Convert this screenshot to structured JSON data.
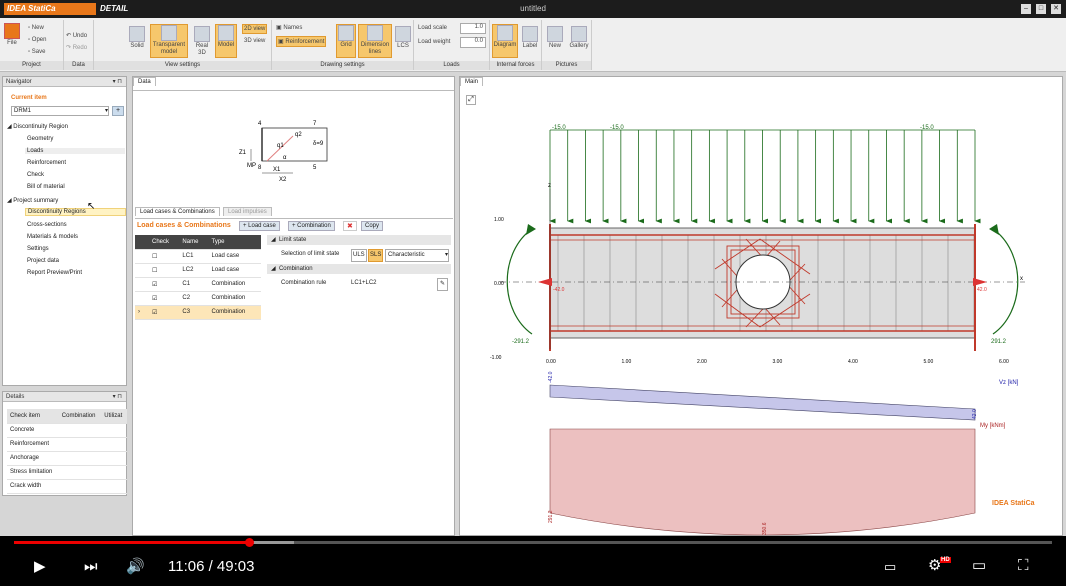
{
  "window": {
    "brand": "IDEA StatiCa",
    "app": "DETAIL",
    "title": "untitled"
  },
  "ribbon": {
    "file": "File",
    "project": {
      "new": "New",
      "open": "Open",
      "save": "Save",
      "label": "Project"
    },
    "data": {
      "undo": "Undo",
      "redo": "Redo",
      "label": "Data"
    },
    "view": {
      "solid": "Solid",
      "transparent": "Transparent model",
      "real3d": "Real 3D",
      "model": "Model",
      "v2d": "2D view",
      "v3d": "3D view",
      "label": "View settings"
    },
    "drawing": {
      "names": "Names",
      "reinforcement": "Reinforcement",
      "grid": "Grid",
      "dim": "Dimension lines",
      "lcs": "LCS",
      "label": "Drawing settings"
    },
    "loads": {
      "scale_label": "Load scale",
      "scale": "1.0",
      "weight_label": "Load weight",
      "weight": "0.0",
      "label": "Loads"
    },
    "forces": {
      "diagram": "Diagram",
      "label_btn": "Label",
      "label": "Internal forces"
    },
    "pictures": {
      "new": "New",
      "gallery": "Gallery",
      "label": "Pictures"
    }
  },
  "navigator": {
    "title": "Navigator",
    "current_item": "Current item",
    "current_value": "DRM1",
    "tree": [
      "Discontinuity Region",
      "Geometry",
      "Loads",
      "Reinforcement",
      "Check",
      "Bill of material",
      "Project summary",
      "Discontinuity Regions",
      "Cross-sections",
      "Materials & models",
      "Settings",
      "Project data",
      "Report Preview/Print"
    ]
  },
  "details": {
    "title": "Details",
    "headers": [
      "Check item",
      "Combination",
      "Utilizat"
    ],
    "rows": [
      "Concrete",
      "Reinforcement",
      "Anchorage",
      "Stress limitation",
      "Crack width"
    ]
  },
  "data_panel": {
    "tab": "Data",
    "tabs": [
      "Load cases & Combinations",
      "Load impulses"
    ],
    "heading": "Load cases & Combinations",
    "buttons": [
      "Load case",
      "Combination",
      "Copy"
    ],
    "headers": [
      "Check",
      "Name",
      "Type"
    ],
    "rows": [
      {
        "name": "LC1",
        "type": "Load case",
        "checked": false
      },
      {
        "name": "LC2",
        "type": "Load case",
        "checked": false
      },
      {
        "name": "C1",
        "type": "Combination",
        "checked": true
      },
      {
        "name": "C2",
        "type": "Combination",
        "checked": true
      },
      {
        "name": "C3",
        "type": "Combination",
        "checked": true
      }
    ],
    "props": {
      "limit_state": "Limit state",
      "sel_label": "Selection of limit state",
      "uls": "ULS",
      "sls": "SLS",
      "chars": "Characteristic",
      "combination": "Combination",
      "rule_label": "Combination rule",
      "rule": "LC1+LC2"
    },
    "sketch": {
      "n4": "4",
      "n7": "7",
      "n8": "8",
      "n5": "5",
      "q1": "q1",
      "q2": "q2",
      "alpha": "α",
      "delta": "δ=9",
      "z1": "Z1",
      "x1": "X1",
      "x2": "X2",
      "mp": "MP"
    }
  },
  "main_panel": {
    "tab": "Main",
    "loads": [
      "-15.0",
      "-15.0",
      "-15.0"
    ],
    "left_moment": "-291.2",
    "right_moment": "291.2",
    "left_force": "-42.0",
    "right_force": "42.0",
    "z_ticks": [
      "1.00",
      "0.00",
      "-1.00"
    ],
    "x_ticks": [
      "0.00",
      "1.00",
      "2.00",
      "3.00",
      "4.00",
      "5.00",
      "6.00"
    ],
    "vz_label": "Vz [kN]",
    "vz_left": "-42.0",
    "vz_right": "42.0",
    "my_label": "My [kNm]",
    "my_left": "291.2",
    "my_mid": "350.6",
    "axis_x": "x",
    "axis_z": "z",
    "watermark": "IDEA StatiCa"
  },
  "player": {
    "time": "11:06 / 49:03",
    "progress": 0.226,
    "buffered": 0.27
  }
}
